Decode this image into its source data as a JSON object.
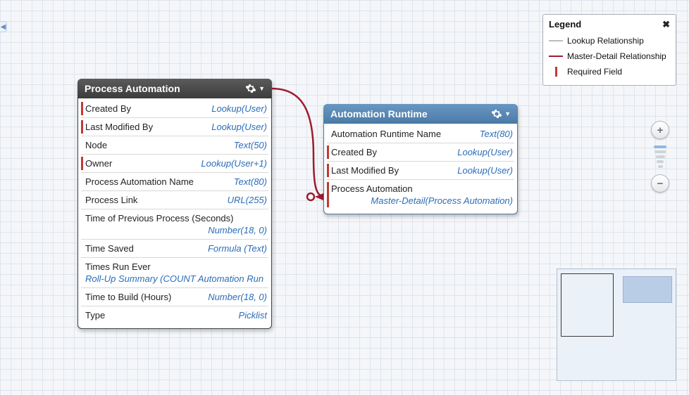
{
  "toggle": "◀",
  "legend": {
    "title": "Legend",
    "items": [
      {
        "label": "Lookup Relationship"
      },
      {
        "label": "Master-Detail Relationship"
      },
      {
        "label": "Required Field"
      }
    ]
  },
  "objects": {
    "processAutomation": {
      "title": "Process Automation",
      "fields": [
        {
          "label": "Created By",
          "type": "Lookup(User)",
          "required": true
        },
        {
          "label": "Last Modified By",
          "type": "Lookup(User)",
          "required": true
        },
        {
          "label": "Node",
          "type": "Text(50)",
          "required": false
        },
        {
          "label": "Owner",
          "type": "Lookup(User+1)",
          "required": true
        },
        {
          "label": "Process Automation Name",
          "type": "Text(80)",
          "required": false
        },
        {
          "label": "Process Link",
          "type": "URL(255)",
          "required": false
        },
        {
          "label": "Time of Previous Process (Seconds)",
          "type": "Number(18, 0)",
          "required": false,
          "wrap": true
        },
        {
          "label": "Time Saved",
          "type": "Formula (Text)",
          "required": false
        },
        {
          "label": "Times Run Ever",
          "type": "Roll-Up Summary (COUNT Automation Run",
          "required": false,
          "wrap": true,
          "left": true
        },
        {
          "label": "Time to Build (Hours)",
          "type": "Number(18, 0)",
          "required": false
        },
        {
          "label": "Type",
          "type": "Picklist",
          "required": false
        }
      ]
    },
    "automationRuntime": {
      "title": "Automation Runtime",
      "fields": [
        {
          "label": "Automation Runtime Name",
          "type": "Text(80)",
          "required": false
        },
        {
          "label": "Created By",
          "type": "Lookup(User)",
          "required": true
        },
        {
          "label": "Last Modified By",
          "type": "Lookup(User)",
          "required": true
        },
        {
          "label": "Process Automation",
          "type": "Master-Detail(Process Automation)",
          "required": true,
          "wrap": true
        }
      ]
    }
  },
  "zoom": {
    "in": "+",
    "out": "−"
  }
}
